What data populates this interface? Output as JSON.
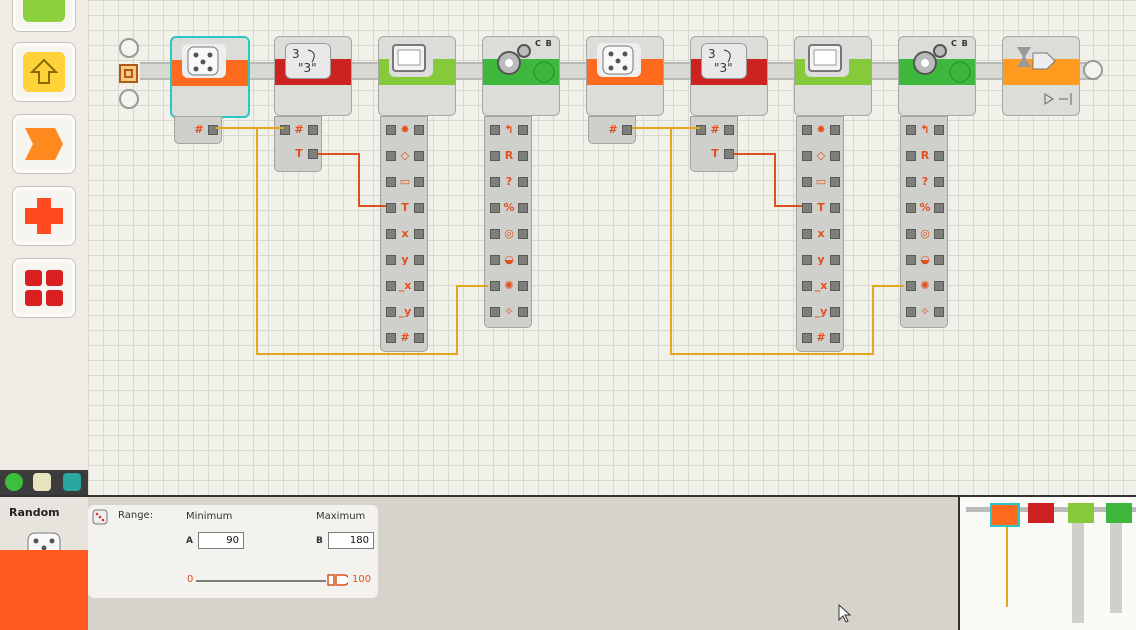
{
  "config": {
    "block_name": "Random",
    "range_label": "Range:",
    "minimum_label": "Minimum",
    "maximum_label": "Maximum",
    "a_label": "A",
    "b_label": "B",
    "min_value": "90",
    "max_value": "180",
    "slider_min": "0",
    "slider_max": "100"
  },
  "program": {
    "blocks": [
      {
        "name": "random-block-1",
        "icon": "dice-icon",
        "color": "#ff6a1f"
      },
      {
        "name": "number-to-text-block-1",
        "icon": "number-to-text-icon",
        "color": "#cc2222"
      },
      {
        "name": "display-block-1",
        "icon": "display-icon",
        "color": "#86c93a"
      },
      {
        "name": "motor-block-1",
        "icon": "motor-icon",
        "color": "#3db83d",
        "badge": "C B"
      },
      {
        "name": "random-block-2",
        "icon": "dice-icon",
        "color": "#ff6a1f"
      },
      {
        "name": "number-to-text-block-2",
        "icon": "number-to-text-icon",
        "color": "#cc2222"
      },
      {
        "name": "display-block-2",
        "icon": "display-icon",
        "color": "#86c93a"
      },
      {
        "name": "motor-block-2",
        "icon": "motor-icon",
        "color": "#3db83d",
        "badge": "C B"
      },
      {
        "name": "loop-block",
        "icon": "loop-icon",
        "color": "#ff9a1f"
      }
    ],
    "motor1_badge": "C B",
    "motor2_badge": "C B"
  },
  "palette": {
    "items": [
      "green-block-icon",
      "move-up-icon",
      "action-icon",
      "sensor-icon",
      "flow-icon"
    ]
  },
  "colors": {
    "wire_number": "#e0a820",
    "wire_text": "#d9531e",
    "accent_orange": "#ff5a1f"
  }
}
